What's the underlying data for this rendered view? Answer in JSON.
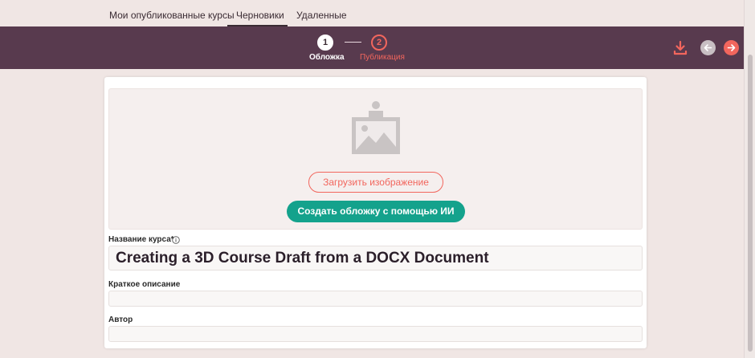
{
  "tabs": {
    "published": "Мои опубликованные курсы",
    "drafts": "Черновики",
    "deleted": "Удаленные"
  },
  "stepper": {
    "step1": {
      "number": "1",
      "label": "Обложка"
    },
    "step2": {
      "number": "2",
      "label": "Публикация"
    }
  },
  "cover": {
    "upload_label": "Загрузить изображение",
    "ai_label": "Создать обложку с помощью ИИ"
  },
  "form": {
    "title_label": "Название курса*",
    "title_value": "Creating a 3D Course Draft from a DOCX Document",
    "description_label": "Краткое описание",
    "description_value": "",
    "author_label": "Автор",
    "author_value": ""
  },
  "colors": {
    "header": "#583a4e",
    "accent": "#f2665d",
    "ai_button": "#14a28c",
    "background": "#f0e6e4"
  },
  "icons": [
    "download-icon",
    "arrow-left-icon",
    "arrow-right-icon",
    "image-placeholder-icon",
    "info-icon"
  ]
}
